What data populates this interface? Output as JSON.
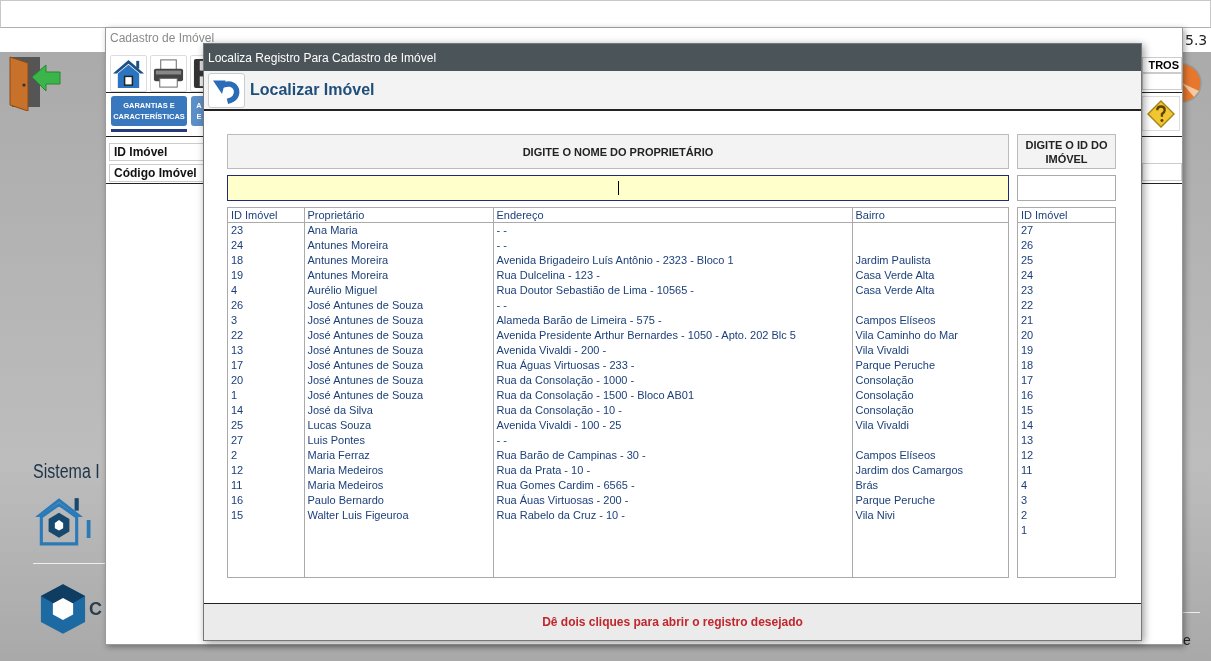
{
  "app": {
    "version": "5.3",
    "brand_text": "Sistema I",
    "logo_text": "I",
    "company_text": "C",
    "corner_text": "e"
  },
  "background_window": {
    "title": "Cadastro de Imóvel",
    "tabs": [
      {
        "lines": [
          "GARANTIAS E",
          "CARACTERÍSTICAS"
        ],
        "selected": true
      },
      {
        "lines": [
          "A",
          "E"
        ],
        "selected": false
      }
    ],
    "fields": [
      {
        "label": "ID Imóvel"
      },
      {
        "label": "Código Imóvel"
      }
    ],
    "side_label": "TROS"
  },
  "dialog": {
    "title": "Localiza Registro Para Cadastro de Imóvel",
    "heading": "Localizar Imóvel",
    "name_search": {
      "label": "DIGITE O NOME DO PROPRIETÁRIO",
      "focused": true
    },
    "id_search": {
      "label": "DIGITE O ID DO IMÓVEL",
      "focused": false
    },
    "table": {
      "columns": [
        "ID Imóvel",
        "Proprietário",
        "Endereço",
        "Bairro"
      ],
      "rows": [
        {
          "id": "23",
          "owner": "Ana Maria",
          "address": " - -"
        },
        {
          "id": "24",
          "owner": "Antunes Moreira",
          "address": " - -"
        },
        {
          "id": "18",
          "owner": "Antunes Moreira",
          "address": "Avenida Brigadeiro Luís Antônio - 2323 - Bloco 1",
          "district": "Jardim Paulista"
        },
        {
          "id": "19",
          "owner": "Antunes Moreira",
          "address": "Rua Dulcelina - 123 -",
          "district": "Casa Verde Alta"
        },
        {
          "id": "4",
          "owner": "Aurélio Miguel",
          "address": "Rua Doutor Sebastião de Lima - 10565 -",
          "district": "Casa Verde Alta"
        },
        {
          "id": "26",
          "owner": "José Antunes de Souza",
          "address": " - -"
        },
        {
          "id": "3",
          "owner": "José Antunes de Souza",
          "address": "Alameda Barão de Limeira - 575 -",
          "district": "Campos Elíseos"
        },
        {
          "id": "22",
          "owner": "José Antunes de Souza",
          "address": "Avenida Presidente Arthur Bernardes - 1050 - Apto. 202 Blc 5",
          "district": "Vila Caminho do Mar"
        },
        {
          "id": "13",
          "owner": "José Antunes de Souza",
          "address": "Avenida Vivaldi - 200 -",
          "district": "Vila Vivaldi"
        },
        {
          "id": "17",
          "owner": "José Antunes de Souza",
          "address": "Rua Águas Virtuosas - 233 -",
          "district": "Parque Peruche"
        },
        {
          "id": "20",
          "owner": "José Antunes de Souza",
          "address": "Rua da Consolação - 1000 -",
          "district": "Consolação"
        },
        {
          "id": "1",
          "owner": "José Antunes de Souza",
          "address": "Rua da Consolação - 1500 - Bloco AB01",
          "district": "Consolação"
        },
        {
          "id": "14",
          "owner": "José da Silva",
          "address": "Rua da Consolação - 10 -",
          "district": "Consolação"
        },
        {
          "id": "25",
          "owner": "Lucas Souza",
          "address": "Avenida Vivaldi - 100 - 25",
          "district": "Vila Vivaldi"
        },
        {
          "id": "27",
          "owner": "Luis Pontes",
          "address": " - -"
        },
        {
          "id": "2",
          "owner": "Maria Ferraz",
          "address": "Rua Barão de Campinas - 30 -",
          "district": "Campos Elíseos"
        },
        {
          "id": "12",
          "owner": "Maria Medeiros",
          "address": "Rua da Prata - 10 -",
          "district": "Jardim dos Camargos"
        },
        {
          "id": "11",
          "owner": "Maria Medeiros",
          "address": "Rua Gomes Cardim - 6565 -",
          "district": "Brás"
        },
        {
          "id": "16",
          "owner": "Paulo Bernardo",
          "address": "Rua Áuas Virtuosas - 200 -",
          "district": "Parque Peruche"
        },
        {
          "id": "15",
          "owner": "Walter Luis Figeuroa",
          "address": "Rua Rabelo da Cruz - 10 -",
          "district": "Vila Nivi"
        }
      ]
    },
    "id_list": {
      "column": "ID Imóvel",
      "items": [
        "27",
        "26",
        "25",
        "24",
        "23",
        "22",
        "21",
        "20",
        "19",
        "18",
        "17",
        "16",
        "15",
        "14",
        "13",
        "12",
        "11",
        "4",
        "3",
        "2",
        "1"
      ]
    },
    "footer": "Dê dois cliques para abrir o registro desejado"
  }
}
